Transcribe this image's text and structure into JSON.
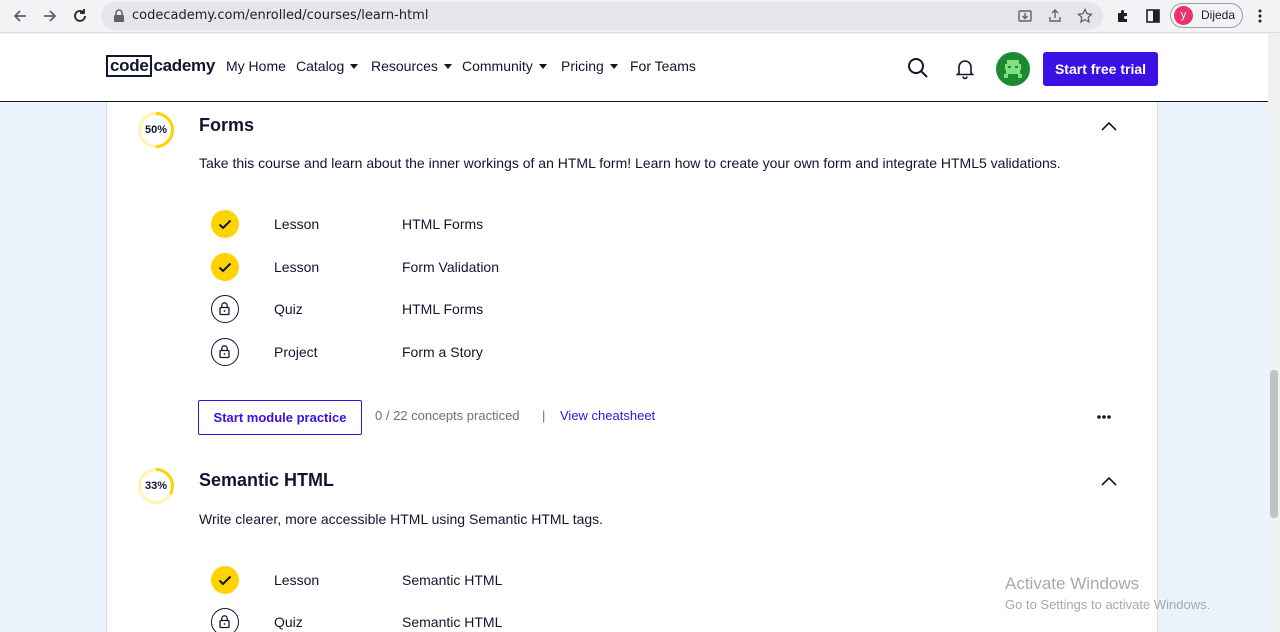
{
  "browser": {
    "url": "codecademy.com/enrolled/courses/learn-html",
    "profile_initial": "y",
    "profile_name": "Dijeda"
  },
  "header": {
    "logo_box": "code",
    "logo_rest": "cademy",
    "nav": [
      "My Home",
      "Catalog",
      "Resources",
      "Community",
      "Pricing",
      "For Teams"
    ],
    "trial_button": "Start free trial"
  },
  "modules": [
    {
      "progress": "50%",
      "progress_value": 0.5,
      "title": "Forms",
      "description": "Take this course and learn about the inner workings of an HTML form! Learn how to create your own form and integrate HTML5 validations.",
      "items": [
        {
          "type": "Lesson",
          "name": "HTML Forms",
          "status": "complete"
        },
        {
          "type": "Lesson",
          "name": "Form Validation",
          "status": "complete"
        },
        {
          "type": "Quiz",
          "name": "HTML Forms",
          "status": "locked"
        },
        {
          "type": "Project",
          "name": "Form a Story",
          "status": "locked"
        }
      ],
      "practice_button": "Start module practice",
      "concepts": "0 / 22 concepts practiced",
      "separator": "|",
      "cheatsheet": "View cheatsheet"
    },
    {
      "progress": "33%",
      "progress_value": 0.33,
      "title": "Semantic HTML",
      "description": "Write clearer, more accessible HTML using Semantic HTML tags.",
      "items": [
        {
          "type": "Lesson",
          "name": "Semantic HTML",
          "status": "complete"
        },
        {
          "type": "Quiz",
          "name": "Semantic HTML",
          "status": "locked"
        }
      ]
    }
  ],
  "watermark": {
    "title": "Activate Windows",
    "subtitle": "Go to Settings to activate Windows."
  },
  "colors": {
    "brand": "#3a10e5",
    "complete": "#ffd300",
    "text": "#10162f"
  }
}
